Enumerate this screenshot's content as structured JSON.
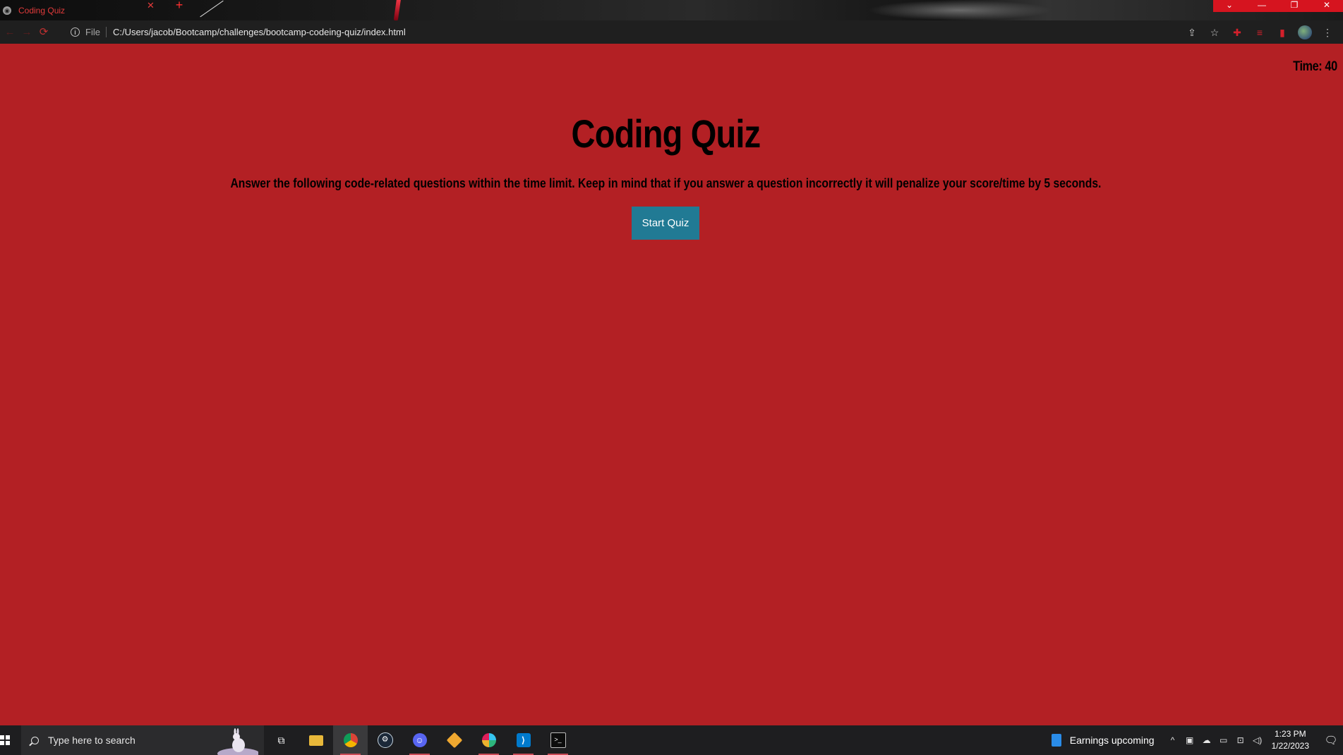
{
  "browser": {
    "tab_title": "Coding Quiz",
    "tab_close": "✕",
    "new_tab": "+",
    "scheme_label": "File",
    "url": "C:/Users/jacob/Bootcamp/challenges/bootcamp-codeing-quiz/index.html",
    "window_controls": [
      "⌄",
      "—",
      "❐",
      "✕"
    ]
  },
  "page": {
    "timer": "Time: 40",
    "title": "Coding Quiz",
    "instructions": "Answer the following code-related questions within the time limit. Keep in mind that if you answer a question incorrectly it will penalize your score/time by 5 seconds.",
    "start_button": "Start Quiz",
    "background_color": "#b32024",
    "button_color": "#217a94"
  },
  "taskbar": {
    "search_placeholder": "Type here to search",
    "widget_text": "Earnings upcoming",
    "clock_time": "1:23 PM",
    "clock_date": "1/22/2023",
    "apps": [
      "task-view-icon",
      "file-explorer-icon",
      "chrome-icon",
      "steam-icon",
      "discord-icon",
      "git-icon",
      "slack-icon",
      "vscode-icon",
      "terminal-icon"
    ]
  }
}
